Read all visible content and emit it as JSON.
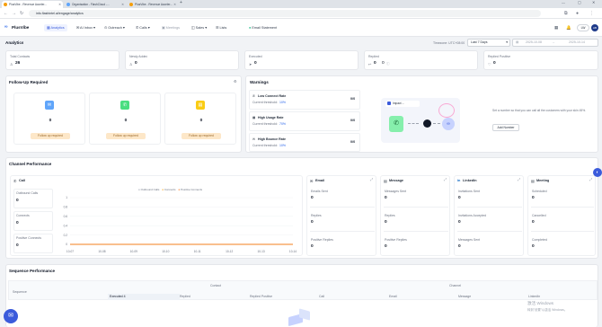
{
  "browser": {
    "tabs": [
      {
        "label": "PlusVibe - Revenue Acceler..."
      },
      {
        "label": "Organisation - FlashCloud -..."
      },
      {
        "label": "PlusVibe - Revenue Acceler..."
      }
    ],
    "url": "info.flashintel.ai/engage/analytics"
  },
  "app": {
    "brand": "PlusVibe",
    "nav": [
      {
        "label": "Analytics"
      },
      {
        "label": "AI Inbox"
      },
      {
        "label": "Outreach"
      },
      {
        "label": "Calls"
      },
      {
        "label": "Meetings"
      },
      {
        "label": "Sales"
      },
      {
        "label": "Lists"
      }
    ],
    "invite_label": "Email Statement",
    "user_initials": "LW"
  },
  "analytics": {
    "title": "Analytics",
    "timezone_label": "Timezone: UTC+08:00",
    "range_label": "Last 7 Days",
    "date_from": "2025-10-08",
    "date_to": "2025-10-14",
    "stats": [
      {
        "label": "Total Contacts",
        "value": "26"
      },
      {
        "label": "Newly Added",
        "value": "0"
      },
      {
        "label": "Executed",
        "value": "0"
      },
      {
        "label": "Replied",
        "value": "0",
        "extra": "0"
      },
      {
        "label": "Replied Positive",
        "value": "0"
      }
    ]
  },
  "followup": {
    "title": "Follow-Up Required",
    "tiles": [
      {
        "value": "0",
        "button": "Follow up required"
      },
      {
        "value": "0",
        "button": "Follow up required"
      },
      {
        "value": "0",
        "button": "Follow up required"
      }
    ]
  },
  "warnings": {
    "title": "Warnings",
    "items": [
      {
        "title": "Low Connect Rate",
        "sub": "Current threshold:",
        "thr": "10%",
        "value": "0/0"
      },
      {
        "title": "High Usage Rate",
        "sub": "Current threshold:",
        "thr": "70%",
        "value": "0/0"
      },
      {
        "title": "High Bounce Rate",
        "sub": "Current threshold:",
        "thr": "10%",
        "value": "0/0"
      }
    ],
    "impact_label": "Impact ...",
    "desc": "Set a number so that you can call all the customers with your skin 45%.",
    "add_button": "Add Number"
  },
  "channel": {
    "title": "Channel Performance",
    "call": {
      "title": "Call",
      "legend": [
        "Outbound Calls",
        "Connects",
        "Positive Connects"
      ],
      "stats": [
        {
          "label": "Outbound Calls",
          "value": "0"
        },
        {
          "label": "Connects",
          "value": "0"
        },
        {
          "label": "Positive Connects",
          "value": "0"
        }
      ]
    },
    "email": {
      "title": "Email",
      "stats": [
        {
          "label": "Emails Sent",
          "value": "0"
        },
        {
          "label": "Replies",
          "value": "0"
        },
        {
          "label": "Positive Replies",
          "value": "0"
        }
      ]
    },
    "message": {
      "title": "Message",
      "stats": [
        {
          "label": "Messages Sent",
          "value": "0"
        },
        {
          "label": "Replies",
          "value": "0"
        },
        {
          "label": "Positive Replies",
          "value": "0"
        }
      ]
    },
    "linkedin": {
      "title": "LinkedIn",
      "stats": [
        {
          "label": "Invitations Sent",
          "value": "0"
        },
        {
          "label": "Invitations Accepted",
          "value": "0"
        },
        {
          "label": "Messages Sent",
          "value": "0"
        }
      ]
    },
    "meeting": {
      "title": "Meeting",
      "stats": [
        {
          "label": "Scheduled",
          "value": "0"
        },
        {
          "label": "Cancelled",
          "value": "0"
        },
        {
          "label": "Completed",
          "value": "0"
        }
      ]
    }
  },
  "sequence": {
    "title": "Sequence Performance",
    "group_contact": "Contact",
    "group_channel": "Channel",
    "columns": [
      "Sequence",
      "Executed",
      "Replied",
      "Replied Positive",
      "Call",
      "Email",
      "Message",
      "LinkedIn"
    ],
    "executed_count": "4"
  },
  "watermark": {
    "line1": "激活 Windows",
    "line2": "转到\"设置\"以激活 Windows。"
  },
  "chart_data": {
    "type": "line",
    "x": [
      "10-07",
      "10-08",
      "10-09",
      "10-10",
      "10-11",
      "10-12",
      "10-13",
      "10-14"
    ],
    "series": [
      {
        "name": "Outbound Calls",
        "values": [
          0,
          0,
          0,
          0,
          0,
          0,
          0,
          0
        ]
      },
      {
        "name": "Connects",
        "values": [
          0,
          0,
          0,
          0,
          0,
          0,
          0,
          0
        ]
      },
      {
        "name": "Positive Connects",
        "values": [
          0,
          0,
          0,
          0,
          0,
          0,
          0,
          0
        ]
      }
    ],
    "ylim": [
      0,
      1
    ],
    "yticks": [
      "1",
      "0.8",
      "0.6",
      "0.4",
      "0.2",
      "0"
    ],
    "legend": "top-center",
    "colors": {
      "Outbound Calls": "#9ca3af",
      "Connects": "#f59e0b",
      "Positive Connects": "#f97316"
    }
  }
}
